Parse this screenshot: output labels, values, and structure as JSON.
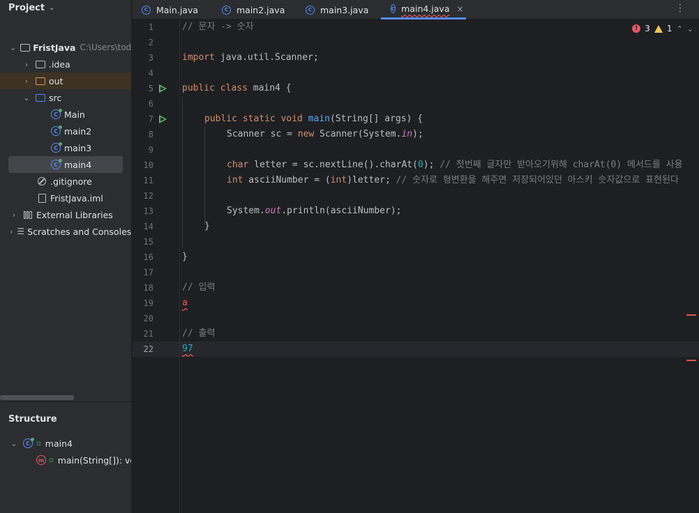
{
  "project_panel": {
    "title": "Project",
    "tree": [
      {
        "label": "FristJava",
        "hint": "C:\\Users\\todlc",
        "kind": "module"
      },
      {
        "label": ".idea",
        "kind": "folder"
      },
      {
        "label": "out",
        "kind": "folder-excluded"
      },
      {
        "label": "src",
        "kind": "source-folder"
      },
      {
        "label": "Main",
        "kind": "class"
      },
      {
        "label": "main2",
        "kind": "class"
      },
      {
        "label": "main3",
        "kind": "class"
      },
      {
        "label": "main4",
        "kind": "class",
        "selected": true
      },
      {
        "label": ".gitignore",
        "kind": "ignore-file"
      },
      {
        "label": "FristJava.iml",
        "kind": "file"
      },
      {
        "label": "External Libraries",
        "kind": "libraries"
      },
      {
        "label": "Scratches and Consoles",
        "kind": "scratches"
      }
    ]
  },
  "structure_panel": {
    "title": "Structure",
    "items": [
      {
        "label": "main4"
      },
      {
        "label": "main(String[]): void"
      }
    ]
  },
  "tabs": [
    {
      "label": "Main.java",
      "active": false
    },
    {
      "label": "main2.java",
      "active": false
    },
    {
      "label": "main3.java",
      "active": false
    },
    {
      "label": "main4.java",
      "active": true,
      "close": "×"
    }
  ],
  "inspections": {
    "errors": "3",
    "warnings": "1"
  },
  "editor": {
    "current_line": 22,
    "line_numbers": [
      "1",
      "2",
      "3",
      "4",
      "5",
      "6",
      "7",
      "8",
      "9",
      "10",
      "11",
      "12",
      "13",
      "14",
      "15",
      "16",
      "17",
      "18",
      "19",
      "20",
      "21",
      "22"
    ],
    "code": {
      "l1": "// 문자 -> 숫자",
      "l3_kw": "import",
      "l3_rest": " java.util.Scanner;",
      "l5_kw": "public class",
      "l5_rest": " main4 {",
      "l7_kw": "public static void",
      "l7_fn": "main",
      "l7_rest": "(String[] args) {",
      "l8_a": "Scanner sc = ",
      "l8_kw": "new",
      "l8_b": " Scanner(System.",
      "l8_in": "in",
      "l8_c": ");",
      "l10_kw": "char",
      "l10_a": " letter = sc.nextLine().charAt(",
      "l10_num": "0",
      "l10_b": "); ",
      "l10_cm": "// 첫번째 글자만 받아오기위해 charAt(0) 메서드를 사용",
      "l11_kw": "int",
      "l11_a": " asciiNumber = (",
      "l11_kw2": "int",
      "l11_b": ")letter; ",
      "l11_cm": "// 숫자로 형변환을 해주면 저장되어있던 아스키 숫자값으로 표현된다",
      "l13_a": "System.",
      "l13_out": "out",
      "l13_b": ".println(asciiNumber);",
      "l14": "}",
      "l16": "}",
      "l18": "// 입력",
      "l19": "a",
      "l21": "// 출력",
      "l22": "97"
    }
  }
}
